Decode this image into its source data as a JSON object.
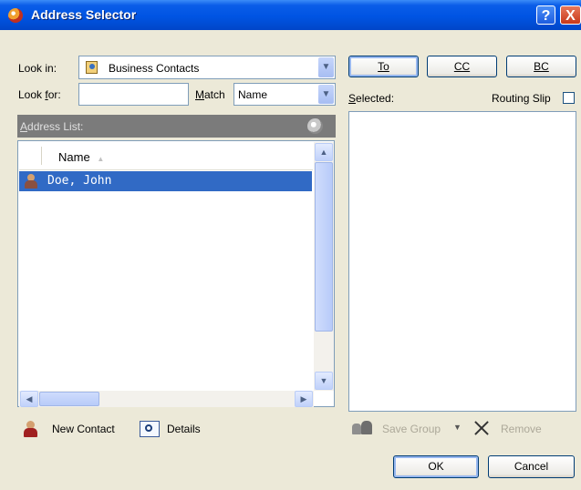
{
  "window": {
    "title": "Address Selector"
  },
  "look_in": {
    "label": "Look in:",
    "value": "Business Contacts"
  },
  "look_for": {
    "label": "Look for:",
    "value": ""
  },
  "match": {
    "label": "Match",
    "value": "Name"
  },
  "address_list": {
    "label": "Address List:",
    "column": "Name",
    "sort_indicator": "▲",
    "rows": [
      {
        "name": "Doe, John",
        "selected": true
      }
    ]
  },
  "recipient_buttons": {
    "to": "To",
    "cc": "CC",
    "bc": "BC"
  },
  "selected_label": "Selected:",
  "routing_slip": {
    "label": "Routing Slip",
    "checked": false
  },
  "actions": {
    "new_contact": "New Contact",
    "details": "Details",
    "save_group": "Save Group",
    "remove": "Remove"
  },
  "dialog": {
    "ok": "OK",
    "cancel": "Cancel"
  },
  "titlebar_buttons": {
    "help": "?",
    "close": "X"
  },
  "colors": {
    "titlebar": "#0054E3",
    "selection": "#316AC5",
    "dialog_bg": "#ECE9D8"
  }
}
